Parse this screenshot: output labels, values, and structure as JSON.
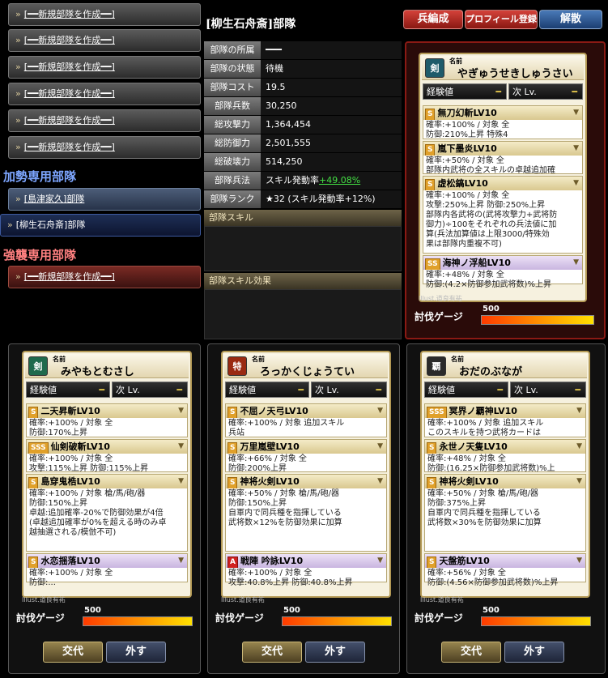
{
  "sidebar": {
    "new_unit_buttons": [
      "[━━新規部隊を作成━━]",
      "[━━新規部隊を作成━━]",
      "[━━新規部隊を作成━━]",
      "[━━新規部隊を作成━━]",
      "[━━新規部隊を作成━━]",
      "[━━新規部隊を作成━━]"
    ],
    "support_header": "加勢専用部隊",
    "support_unit": "[島津家久]部隊",
    "selected_unit": "[柳生石舟斎]部隊",
    "raid_header": "強襲専用部隊",
    "raid_unit": "[━━新規部隊を作成━━]"
  },
  "panel": {
    "title": "[柳生石舟斎]部隊",
    "buttons": {
      "formation": "兵編成",
      "profile": "プロフィール登録",
      "disband": "解散"
    },
    "info": [
      {
        "label": "部隊の所属",
        "value": "━━━"
      },
      {
        "label": "部隊の状態",
        "value": "待機"
      },
      {
        "label": "部隊コスト",
        "value": "19.5"
      },
      {
        "label": "部隊兵数",
        "value": "30,250"
      },
      {
        "label": "総攻撃力",
        "value": "1,364,454"
      },
      {
        "label": "総防御力",
        "value": "2,501,555"
      },
      {
        "label": "総破壊力",
        "value": "514,250"
      }
    ],
    "troop_skill_label": "部隊兵法",
    "troop_skill_value": "スキル発動率",
    "troop_skill_bonus": "+49.08%",
    "rank_label": "部隊ランク",
    "rank_value": "★32 (スキル発動率+12%)",
    "unit_skill_header": "部隊スキル",
    "unit_skill_effect_header": "部隊スキル効果"
  },
  "common": {
    "name_label": "名前",
    "exp_label": "経験値",
    "next_label": "次 Lv.",
    "dash": "━",
    "gauge_label": "討伐ゲージ",
    "swap_button": "交代",
    "remove_button": "外す"
  },
  "cards": [
    {
      "icon": "剣",
      "icon_name": "sword-icon",
      "icon_color": "#1f5b6a",
      "name": "やぎゅうせきしゅうさい",
      "credit": "Illust.道良有祐",
      "gauge": "500",
      "skills": [
        {
          "rank": "S",
          "name": "無刀幻斬LV10",
          "purple": false,
          "lines": [
            "確率:+100% / 対象 全",
            "防御:210%上昇 特殊4"
          ]
        },
        {
          "rank": "S",
          "name": "嵐下墨炎LV10",
          "purple": false,
          "lines": [
            "確率:+50% / 対象 全",
            "部隊内武将の全スキルの卓越追加確"
          ]
        },
        {
          "rank": "S",
          "name": "虚松鎬LV10",
          "purple": false,
          "lines": [
            "確率:+100% / 対象 全",
            "攻撃:250%上昇 防御:250%上昇",
            "部隊内各武将の(武将攻撃力+武将防",
            "御力)÷100をそれぞれの兵法値に加",
            "算(兵法加算値は上限3000/特殊効",
            "果は部隊内重複不可)"
          ]
        },
        {
          "rank": "SS",
          "name": "海神ノ浮船LV10",
          "purple": true,
          "lines": [
            "確率:+48% / 対象 全",
            "防御:(4.2×防御参加武将数)%上昇"
          ]
        }
      ]
    },
    {
      "icon": "剣",
      "icon_name": "sword-icon",
      "icon_color": "#1f6a4d",
      "name": "みやもとむさし",
      "credit": "Illust.道良有祐",
      "gauge": "500",
      "skills": [
        {
          "rank": "S",
          "name": "二天昇斬LV10",
          "purple": false,
          "lines": [
            "確率:+100% / 対象 全",
            "防御:170%上昇"
          ]
        },
        {
          "rank": "SSS",
          "name": "仙剣破斬LV10",
          "purple": false,
          "lines": [
            "確率:+100% / 対象 全",
            "攻撃:115%上昇 防御:115%上昇"
          ]
        },
        {
          "rank": "S",
          "name": "島穿鬼梏LV10",
          "purple": false,
          "lines": [
            "確率:+100% / 対象 槍/馬/砲/器",
            "防御:150%上昇",
            "卓越:追加確率-20%で防御効果が4倍",
            "(卓越追加確率が0%を超える時のみ卓",
            "越抽選される/模倣不可)"
          ]
        },
        {
          "rank": "S",
          "name": "水恋揺落LV10",
          "purple": true,
          "lines": [
            "確率:+100% / 対象 全",
            "防御:..."
          ]
        }
      ]
    },
    {
      "icon": "特",
      "icon_name": "special-icon",
      "icon_color": "#9a2a12",
      "name": "ろっかくじょうてい",
      "credit": "Illust.道良有祐",
      "gauge": "500",
      "skills": [
        {
          "rank": "S",
          "name": "不屈ノ天弓LV10",
          "purple": false,
          "lines": [
            "確率:+100% / 対象 追加スキル",
            "兵站"
          ]
        },
        {
          "rank": "S",
          "name": "万里嵐壁LV10",
          "purple": false,
          "lines": [
            "確率:+66% / 対象 全",
            "防御:200%上昇"
          ]
        },
        {
          "rank": "S",
          "name": "神将火剣LV10",
          "purple": false,
          "lines": [
            "確率:+50% / 対象 槍/馬/砲/器",
            "防御:150%上昇",
            "自軍内で同兵種を指揮している",
            "武将数×12%を防御効果に加算"
          ]
        },
        {
          "rank": "A",
          "name": "戦陣 吟詠LV10",
          "purple": true,
          "lines": [
            "確率:+100% / 対象 全",
            "攻撃:40.8%上昇 防御:40.8%上昇"
          ]
        }
      ]
    },
    {
      "icon": "覇",
      "icon_name": "hegemon-icon",
      "icon_color": "#2a2a2a",
      "name": "おだのぶなが",
      "credit": "Illust.道良有祐",
      "gauge": "500",
      "skills": [
        {
          "rank": "SSS",
          "name": "冥界ノ覇神LV10",
          "purple": false,
          "lines": [
            "確率:+100% / 対象 追加スキル",
            "このスキルを持つ武将カードは"
          ]
        },
        {
          "rank": "S",
          "name": "永世ノ天隻LV10",
          "purple": false,
          "lines": [
            "確率:+48% / 対象 全",
            "防御:(16.25×防御参加武将数)%上"
          ]
        },
        {
          "rank": "S",
          "name": "神将火剣LV10",
          "purple": false,
          "lines": [
            "確率:+50% / 対象 槍/馬/砲/器",
            "防御:375%上昇",
            "自軍内で同兵種を指揮している",
            "武将数×30%を防御効果に加算"
          ]
        },
        {
          "rank": "S",
          "name": "天盤筋LV10",
          "purple": true,
          "lines": [
            "確率:+56% / 対象 全",
            "防御:(4.56×防御参加武将数)%上昇"
          ]
        }
      ]
    }
  ]
}
